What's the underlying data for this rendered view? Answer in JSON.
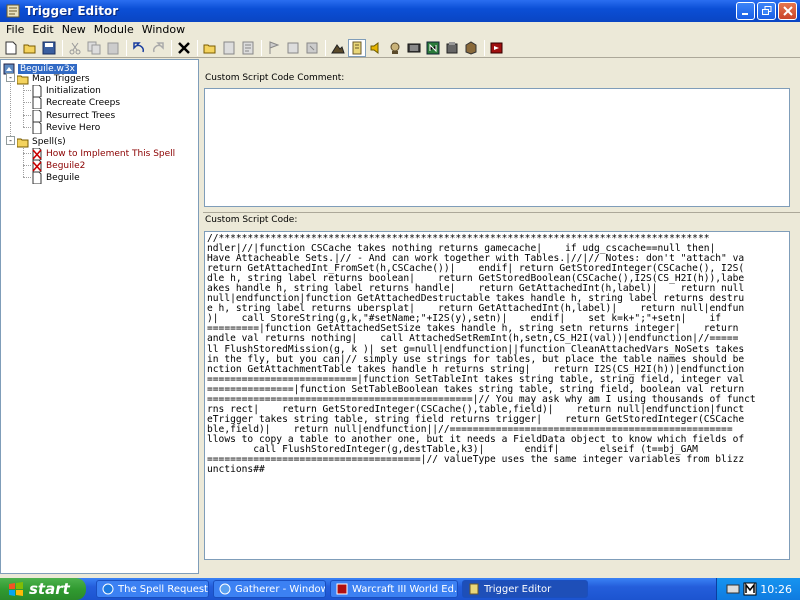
{
  "window": {
    "title": "Trigger Editor"
  },
  "menu": [
    "File",
    "Edit",
    "New",
    "Module",
    "Window"
  ],
  "toolbar_icons": [
    "new-icon",
    "open-icon",
    "save-icon",
    "cut-icon",
    "copy-icon",
    "paste-icon",
    "undo-icon",
    "redo-icon",
    "delete-x-icon",
    "new-category-icon",
    "new-trigger-icon",
    "new-comment-icon",
    "new-event-icon",
    "new-condition-icon",
    "new-action-icon",
    "terrain-editor-icon",
    "trigger-editor-icon",
    "sound-editor-icon",
    "object-editor-icon",
    "campaign-editor-icon",
    "ai-editor-icon",
    "object-manager-icon",
    "import-manager-icon",
    "test-map-icon"
  ],
  "tree": {
    "root": "Beguile.w3x",
    "category_map": "Map Triggers",
    "map_triggers": [
      "Initialization",
      "Recreate Creeps",
      "Resurrect Trees",
      "Revive Hero"
    ],
    "category_spell": "Spell(s)",
    "spell_triggers": [
      "How to Implement This Spell",
      "Beguile2",
      "Beguile"
    ]
  },
  "right": {
    "comment_label": "Custom Script Code Comment:",
    "code_label": "Custom Script Code:",
    "code_lines": [
      "//*************************************************************************************",
      "ndler|//|function CSCache takes nothing returns gamecache|    if udg_cscache==null then|",
      "Have Attacheable Sets.|// - And can work together with Tables.|//|// Notes: don't \"attach\" va",
      "return GetAttachedInt_FromSet(h,CSCache())|    endif| return GetStoredInteger(CSCache(), I2S(",
      "dle h, string label returns boolean|    return GetStoredBoolean(CSCache(),I2S(CS_H2I(h)),labe",
      "akes handle h, string label returns handle|    return GetAttachedInt(h,label)|    return null",
      "null|endfunction|function GetAttachedDestructable takes handle h, string label returns destru",
      "e h, string label returns ubersplat|    return GetAttachedInt(h,label)|    return null|endfun",
      ")|    call StoreString(g,k,\"#setName;\"+I2S(y),setn)|    endif|    set k=k+\";\"+setn|    if",
      "=========|function GetAttachedSetSize takes handle h, string setn returns integer|    return",
      "andle val returns nothing|    call AttachedSetRemInt(h,setn,CS_H2I(val))|endfunction|//=====",
      "ll FlushStoredMission(g, k )| set g=null|endfunction||function CleanAttachedVars_NoSets takes",
      "in the fly, but you can|// simply use strings for tables, but place the table names should be",
      "nction GetAttachmentTable takes handle h returns string|    return I2S(CS_H2I(h))|endfunction",
      "==========================|function SetTableInt takes string table, string field, integer val",
      "===============|function SetTableBoolean takes string table, string field, boolean val return",
      "==============================================|// You may ask why am I using thousands of funct",
      "rns rect|    return GetStoredInteger(CSCache(),table,field)|    return null|endfunction|funct",
      "eTrigger takes string table, string field returns trigger|    return GetStoredInteger(CSCache",
      "ble,field)|    return null|endfunction||//=================================================",
      "llows to copy a table to another one, but it needs a FieldData object to know which fields of",
      "        call FlushStoredInteger(g,destTable,k3)|       endif|       elseif (t==bj_GAM",
      "=====================================|// valueType uses the same integer variables from blizz",
      "unctions##"
    ]
  },
  "taskbar": {
    "start": "start",
    "tasks": [
      "The Spell Request Th...",
      "Gatherer - Windows I...",
      "Warcraft III World Ed...",
      "Trigger Editor"
    ],
    "time": "10:26"
  }
}
